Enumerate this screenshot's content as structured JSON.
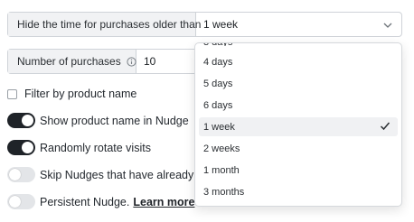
{
  "hide_time": {
    "label": "Hide the time for purchases older than",
    "value": "1 week"
  },
  "num_purchases": {
    "label": "Number of purchases",
    "value": "10"
  },
  "filter_product": {
    "label": "Filter by product name",
    "checked": false
  },
  "toggles": [
    {
      "label": "Show product name in Nudge",
      "on": true
    },
    {
      "label": "Randomly rotate visits",
      "on": true
    },
    {
      "label": "Skip Nudges that have already",
      "on": false
    },
    {
      "label": "Persistent Nudge.",
      "on": false,
      "link": "Learn more"
    }
  ],
  "dropdown": {
    "options": [
      "4 days",
      "5 days",
      "6 days",
      "1 week",
      "2 weeks",
      "1 month",
      "3 months"
    ],
    "selected": "1 week"
  },
  "colors": {
    "toggle_on": "#1f2328",
    "toggle_off": "#e3e5e8",
    "selected_bg": "#f0f1f3"
  }
}
